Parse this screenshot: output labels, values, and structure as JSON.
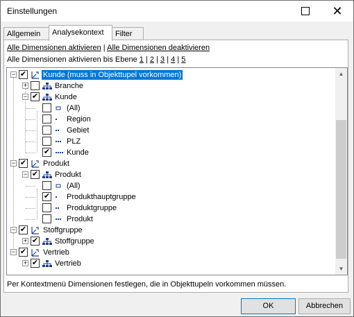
{
  "window": {
    "title": "Einstellungen"
  },
  "tabs": [
    {
      "label": "Allgemein",
      "active": false
    },
    {
      "label": "Analysekontext",
      "active": true
    },
    {
      "label": "Filter",
      "active": false
    }
  ],
  "links": {
    "activate_all": "Alle Dimensionen aktivieren",
    "separator": "|",
    "deactivate_all": "Alle Dimensionen deaktivieren"
  },
  "levels": {
    "prefix": "Alle Dimensionen aktivieren bis Ebene",
    "l1": "1",
    "l2": "2",
    "l3": "3",
    "l4": "4",
    "l5": "5",
    "sep": "|"
  },
  "tree": {
    "rows": [
      {
        "label": "Kunde  (muss in Objekttupel vorkommen)",
        "checked": true,
        "icon": "dimension-icon",
        "selected": true
      },
      {
        "label": "Branche",
        "checked": false,
        "icon": "hierarchy-icon"
      },
      {
        "label": "Kunde",
        "checked": true,
        "icon": "hierarchy-icon"
      },
      {
        "label": "(All)",
        "checked": false,
        "icon": "level0-icon"
      },
      {
        "label": "Region",
        "checked": false,
        "icon": "level1-icon"
      },
      {
        "label": "Gebiet",
        "checked": false,
        "icon": "level2-icon"
      },
      {
        "label": "PLZ",
        "checked": false,
        "icon": "level3-icon"
      },
      {
        "label": "Kunde",
        "checked": true,
        "icon": "level4-icon"
      },
      {
        "label": "Produkt",
        "checked": true,
        "icon": "dimension-icon"
      },
      {
        "label": "Produkt",
        "checked": true,
        "icon": "hierarchy-icon"
      },
      {
        "label": "(All)",
        "checked": false,
        "icon": "level0-icon"
      },
      {
        "label": "Produkthauptgruppe",
        "checked": true,
        "icon": "level1-icon"
      },
      {
        "label": "Produktgruppe",
        "checked": false,
        "icon": "level2-icon"
      },
      {
        "label": "Produkt",
        "checked": false,
        "icon": "level3-icon"
      },
      {
        "label": "Stoffgruppe",
        "checked": true,
        "icon": "dimension-icon"
      },
      {
        "label": "Stoffgruppe",
        "checked": true,
        "icon": "hierarchy-icon"
      },
      {
        "label": "Vertrieb",
        "checked": true,
        "icon": "dimension-icon"
      },
      {
        "label": "Vertrieb",
        "checked": true,
        "icon": "hierarchy-icon"
      }
    ]
  },
  "status_text": "Per Kontextmenü Dimensionen festlegen, die in Objekttupeln vorkommen müssen.",
  "buttons": {
    "ok": "OK",
    "cancel": "Abbrechen"
  },
  "colors": {
    "selection": "#0078d7",
    "icon_blue": "#1e3f8f"
  }
}
